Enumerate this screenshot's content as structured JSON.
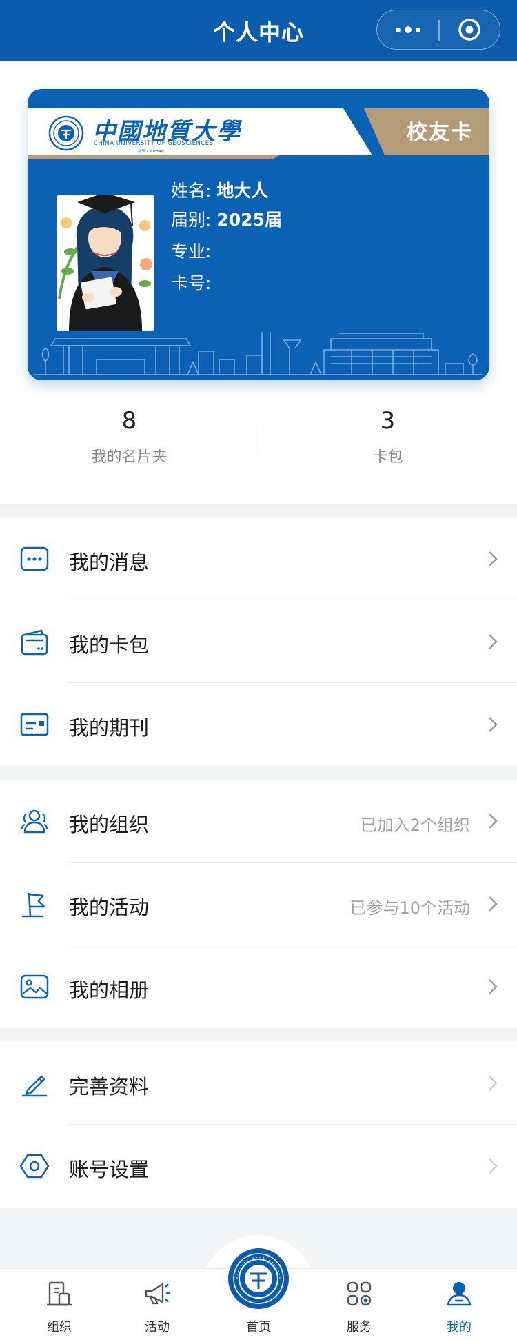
{
  "header": {
    "title": "个人中心"
  },
  "card": {
    "school_name_cn": "中國地質大學",
    "school_name_en": "CHINA UNIVERSITY OF GEOSCIENCES",
    "school_sub": "武汉 · WUHAN",
    "card_type": "校友卡",
    "fields": {
      "name": {
        "label": "姓名:",
        "value": "地大人"
      },
      "class_year": {
        "label": "届别:",
        "value": "2025届"
      },
      "major": {
        "label": "专业:",
        "value": ""
      },
      "card_no": {
        "label": "卡号:",
        "value": ""
      }
    }
  },
  "stats": [
    {
      "value": "8",
      "label": "我的名片夹"
    },
    {
      "value": "3",
      "label": "卡包"
    }
  ],
  "menu": {
    "group1": [
      {
        "label": "我的消息",
        "icon": "message-icon"
      },
      {
        "label": "我的卡包",
        "icon": "wallet-icon"
      },
      {
        "label": "我的期刊",
        "icon": "journal-icon"
      }
    ],
    "group2": [
      {
        "label": "我的组织",
        "icon": "people-icon",
        "extra": "已加入2个组织"
      },
      {
        "label": "我的活动",
        "icon": "flag-icon",
        "extra": "已参与10个活动"
      },
      {
        "label": "我的相册",
        "icon": "photo-icon"
      }
    ],
    "group3": [
      {
        "label": "完善资料",
        "icon": "edit-icon"
      },
      {
        "label": "账号设置",
        "icon": "settings-icon"
      }
    ]
  },
  "tabbar": [
    {
      "label": "组织",
      "icon": "organization-icon"
    },
    {
      "label": "活动",
      "icon": "megaphone-icon"
    },
    {
      "label": "首页",
      "icon": "home-seal-icon"
    },
    {
      "label": "服务",
      "icon": "grid-icon"
    },
    {
      "label": "我的",
      "icon": "user-icon",
      "active": true
    }
  ],
  "colors": {
    "primary": "#0b5cad",
    "card_blue": "#0b62b4",
    "gold": "#b59c78",
    "text_secondary": "#a0a0a0"
  }
}
